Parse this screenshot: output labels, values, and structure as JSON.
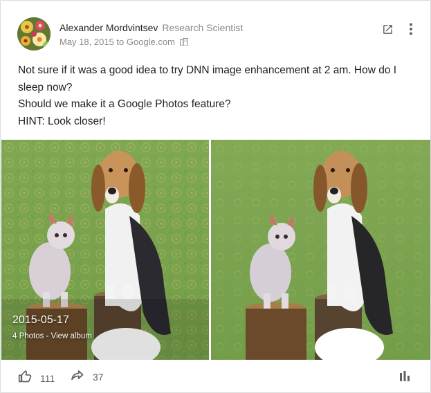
{
  "author": {
    "name": "Alexander Mordvintsev",
    "role": "Research Scientist",
    "avatar_icon": "flower-avatar-icon"
  },
  "meta": {
    "date": "May 18, 2015",
    "target": "to Google.com",
    "audience_icon": "domain-building-icon"
  },
  "header_actions": {
    "open_icon": "open-in-new-icon",
    "menu_icon": "more-vert-icon"
  },
  "post": {
    "lines": [
      "Not sure if it was a good idea to try DNN image enhancement at 2 am. How do I sleep now?",
      "Should we make it a Google Photos feature?",
      "HINT: Look closer!"
    ]
  },
  "album": {
    "date": "2015-05-17",
    "link": "4 Photos - View album",
    "photo_count": 4
  },
  "footer": {
    "plus_icon": "plus-one-icon",
    "plus_count": "111",
    "share_icon": "reshare-arrow-icon",
    "share_count": "37",
    "stats_icon": "bar-chart-icon"
  },
  "colors": {
    "text_primary": "#212121",
    "text_secondary": "#8a8a8a",
    "icon_gray": "#616161",
    "grass": "#7aa150"
  }
}
